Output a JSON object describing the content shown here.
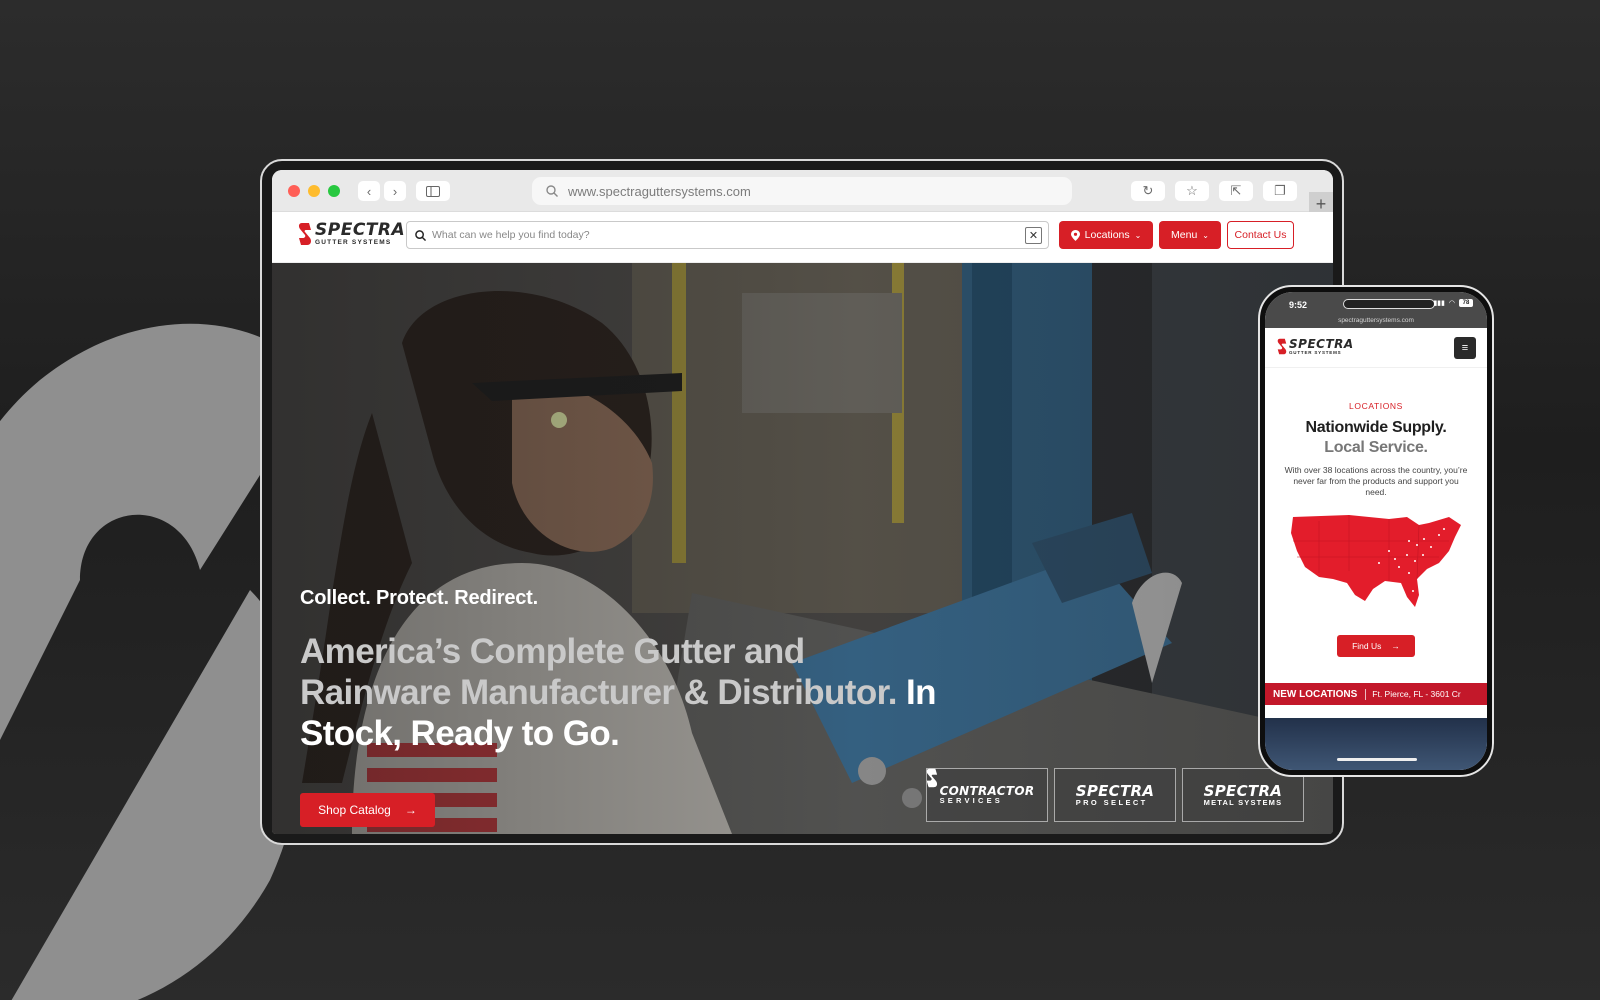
{
  "colors": {
    "brand_red": "#d71f26",
    "background": "#2a2a2a",
    "headline_grey": "#c9c9c9"
  },
  "browser": {
    "url": "www.spectraguttersystems.com",
    "icons": [
      "back-icon",
      "forward-icon",
      "sidebar-icon",
      "search-icon",
      "reload-icon",
      "star-icon",
      "share-icon",
      "tabs-icon",
      "plus-icon"
    ]
  },
  "site": {
    "logo": {
      "name": "SPECTRA",
      "sub": "GUTTER SYSTEMS"
    },
    "search_placeholder": "What can we help you find today?",
    "clear_label": "✕",
    "nav": {
      "locations": "Locations",
      "menu": "Menu",
      "contact": "Contact Us"
    },
    "hero": {
      "tagline": "Collect. Protect. Redirect.",
      "headline_grey": "America’s Complete Gutter and Rainware Manufacturer & Distributor.",
      "headline_white": "In Stock, Ready to Go.",
      "cta": "Shop Catalog"
    },
    "brands": [
      {
        "name": "CONTRACTOR",
        "sub": "SERVICES"
      },
      {
        "name": "SPECTRA",
        "sub": "PRO SELECT"
      },
      {
        "name": "SPECTRA",
        "sub": "METAL SYSTEMS"
      }
    ]
  },
  "phone": {
    "time": "9:52",
    "battery": "78",
    "url": "spectraguttersystems.com",
    "logo": {
      "name": "SPECTRA",
      "sub": "GUTTER SYSTEMS"
    },
    "eyebrow": "LOCATIONS",
    "title_line1": "Nationwide Supply.",
    "title_line2": "Local Service.",
    "body": "With over 38 locations across the country, you’re never far from the products and support you need.",
    "cta": "Find Us",
    "ticker_label": "NEW LOCATIONS",
    "ticker_text": "Ft. Pierce, FL - 3601 Cr"
  }
}
